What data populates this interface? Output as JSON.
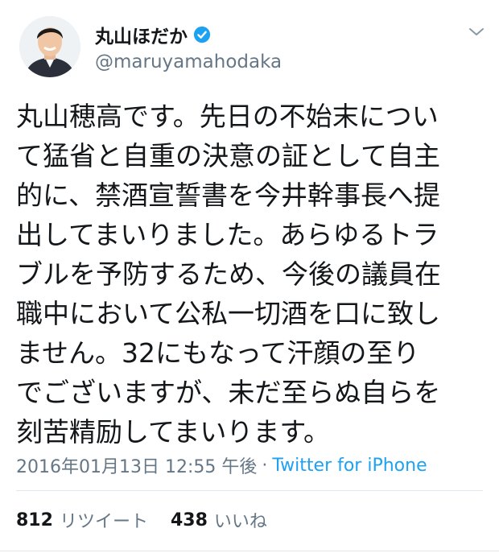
{
  "author": {
    "display_name": "丸山ほだか",
    "handle": "@maruyamahodaka",
    "verified": true
  },
  "tweet": {
    "lines": [
      "丸山穂高です。先日の不始末につい",
      "て猛省と自重の決意の証として自主",
      "的に、禁酒宣誓書を今井幹事長へ提",
      "出してまいりました。あらゆるトラ",
      "ブルを予防するため、今後の議員在",
      "職中において公私一切酒を口に致し",
      "ません。32にもなって汗顔の至り",
      "でございますが、未だ至らぬ自らを",
      "刻苦精励してまいります。"
    ]
  },
  "meta": {
    "timestamp": "2016年01月13日 12:55 午後",
    "separator": "·",
    "source": "Twitter for iPhone"
  },
  "stats": {
    "retweet_count": "812",
    "retweet_label": "リツイート",
    "like_count": "438",
    "like_label": "いいね"
  },
  "icons": [
    "verified-badge-icon",
    "chevron-down-icon"
  ],
  "colors": {
    "accent": "#1da1f2",
    "muted": "#657786",
    "text": "#14171a"
  }
}
